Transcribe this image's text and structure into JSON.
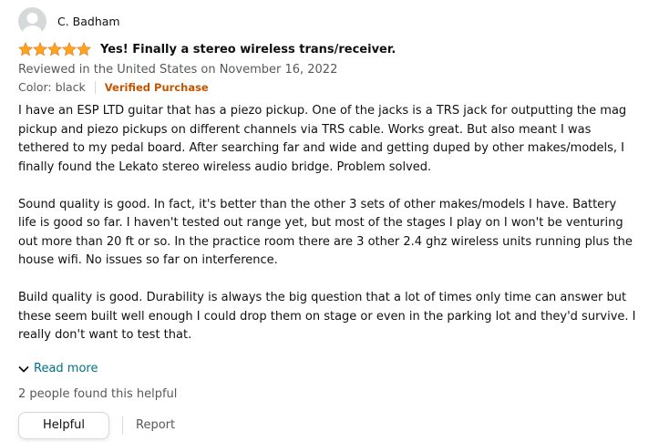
{
  "review": {
    "reviewer_name": "C. Badham",
    "rating": 5,
    "rating_max": 5,
    "star_color": "#ffa41c",
    "title": "Yes! Finally a stereo wireless trans/receiver.",
    "meta": "Reviewed in the United States on November 16, 2022",
    "variant": "Color: black",
    "verified": "Verified Purchase",
    "paragraphs": [
      "I have an ESP LTD guitar that has a piezo pickup. One of the jacks is a TRS jack for outputting the mag pickup and piezo pickups on different channels via TRS cable. Works great. But also meant I was tethered to my pedal board. After searching far and wide and getting duped by other makes/models, I finally found the Lekato stereo wireless audio bridge. Problem solved.",
      "Sound quality is good. In fact, it's better than the other 3 sets of other makes/models I have. Battery life is good so far. I haven't tested out range yet, but most of the stages I play on I won't be venturing out more than 20 ft or so. In the practice room there are 3 other 2.4 ghz wireless units running plus the house wifi. No issues so far on interference.",
      "Build quality is good. Durability is always the big question that a lot of times only time can answer but these seem built well enough I could drop them on stage or even in the parking lot and they'd survive. I really don't want to test that."
    ],
    "read_more": "Read more",
    "helpful_count": "2 people found this helpful",
    "helpful_button": "Helpful",
    "report": "Report"
  }
}
